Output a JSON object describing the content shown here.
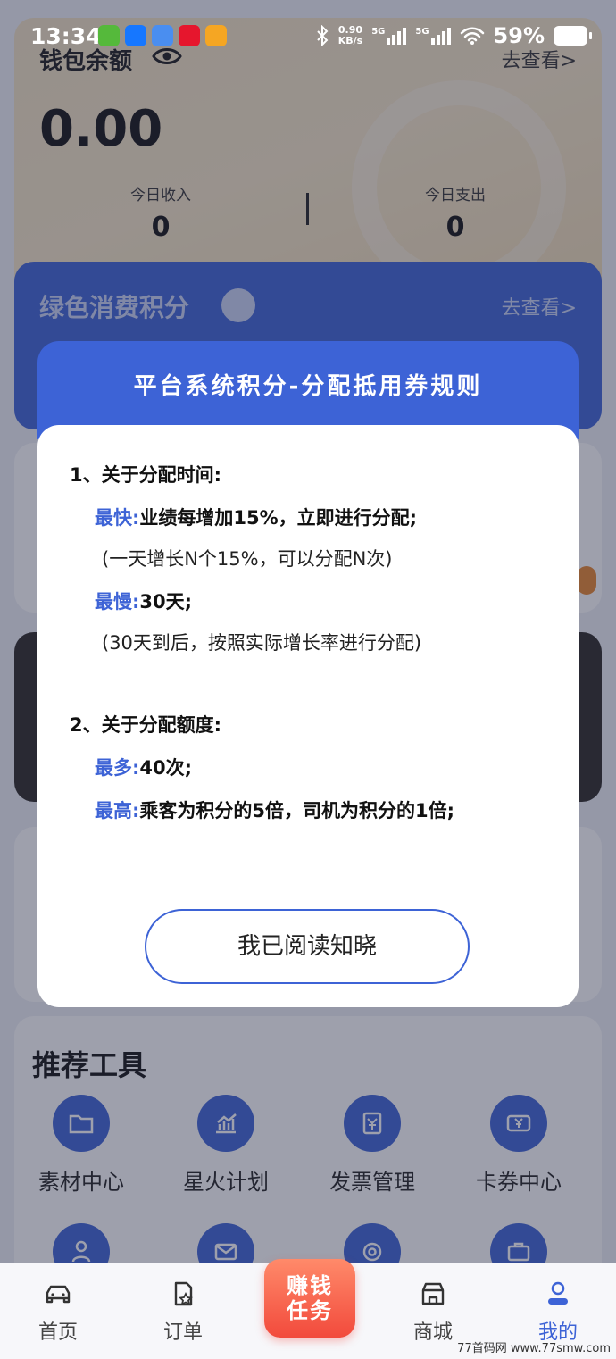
{
  "status_bar": {
    "time": "13:34",
    "net_speed_value": "0.90",
    "net_speed_unit": "KB/s",
    "signal_1_label": "5G",
    "signal_2_label": "5G",
    "battery": "59%"
  },
  "wallet": {
    "title": "钱包余额",
    "link": "去查看>",
    "balance": "0.00",
    "income_label": "今日收入",
    "income_value": "0",
    "expense_label": "今日支出",
    "expense_value": "0"
  },
  "green_points": {
    "title": "绿色消费积分",
    "link": "去查看>"
  },
  "tools": {
    "title": "推荐工具",
    "items": [
      {
        "label": "素材中心",
        "icon": "folder-icon"
      },
      {
        "label": "星火计划",
        "icon": "chart-icon"
      },
      {
        "label": "发票管理",
        "icon": "invoice-icon"
      },
      {
        "label": "卡券中心",
        "icon": "coupon-icon"
      }
    ]
  },
  "bottom_nav": {
    "items": [
      {
        "label": "首页",
        "icon": "car-icon"
      },
      {
        "label": "订单",
        "icon": "order-icon"
      },
      {
        "label": "商城",
        "icon": "store-icon"
      },
      {
        "label": "我的",
        "icon": "user-icon"
      }
    ],
    "active": "我的",
    "task_badge": "赚钱任务"
  },
  "modal": {
    "title": "平台系统积分-分配抵用券规则",
    "section1_title": "1、关于分配时间:",
    "fastest_key": "最快:",
    "fastest_value": "业绩每增加15%，立即进行分配;",
    "fastest_note": "(一天增长N个15%，可以分配N次)",
    "slowest_key": "最慢:",
    "slowest_value": "30天;",
    "slowest_note": "(30天到后，按照实际增长率进行分配)",
    "section2_title": "2、关于分配额度:",
    "most_key": "最多:",
    "most_value": "40次;",
    "highest_key": "最高:",
    "highest_value": "乘客为积分的5倍，司机为积分的1倍;",
    "confirm": "我已阅读知晓"
  },
  "watermark": "77首码网 www.77smw.com",
  "colors": {
    "primary": "#3d63d6",
    "wallet_bg": "#f2e2c3",
    "badge_red": "#f24a3c"
  }
}
